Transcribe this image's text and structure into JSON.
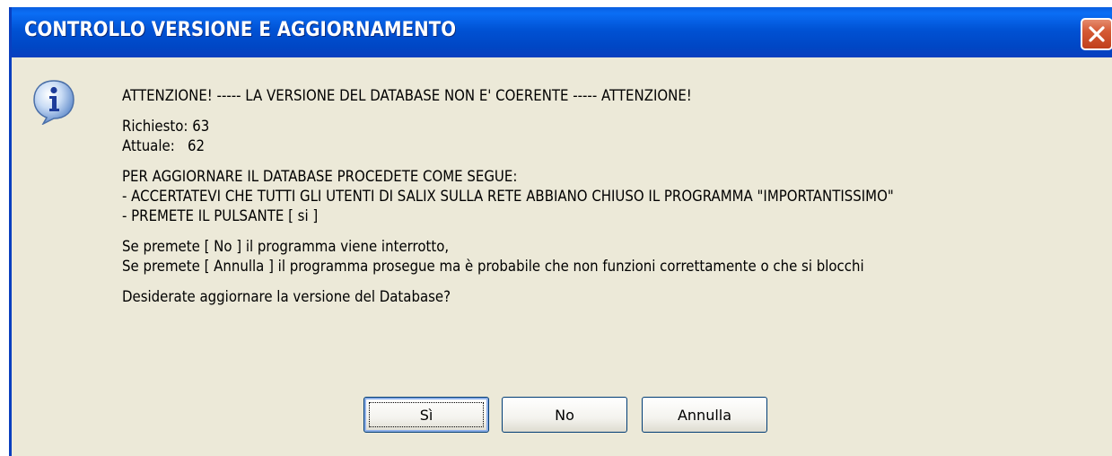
{
  "window": {
    "title": "CONTROLLO VERSIONE E AGGIORNAMENTO",
    "title_bar_color": "#0052d4",
    "close_icon": "close-icon"
  },
  "dialog": {
    "icon": "info-icon",
    "lines": [
      "ATTENZIONE! ----- LA VERSIONE DEL DATABASE NON E' COERENTE ----- ATTENZIONE!",
      "",
      "Richiesto: 63",
      "Attuale:   62",
      "",
      "PER AGGIORNARE IL DATABASE PROCEDETE COME SEGUE:",
      "- ACCERTATEVI CHE TUTTI GLI UTENTI DI SALIX SULLA RETE ABBIANO CHIUSO IL PROGRAMMA \"IMPORTANTISSIMO\"",
      "- PREMETE IL PULSANTE [ si ]",
      "",
      "Se premete [ No ] il programma viene interrotto,",
      "Se premete [ Annulla ] il programma prosegue ma è probabile che non funzioni correttamente o che si blocchi",
      "",
      "Desiderate aggiornare la versione del Database?"
    ]
  },
  "buttons": {
    "yes": "Sì",
    "no": "No",
    "cancel": "Annulla"
  }
}
